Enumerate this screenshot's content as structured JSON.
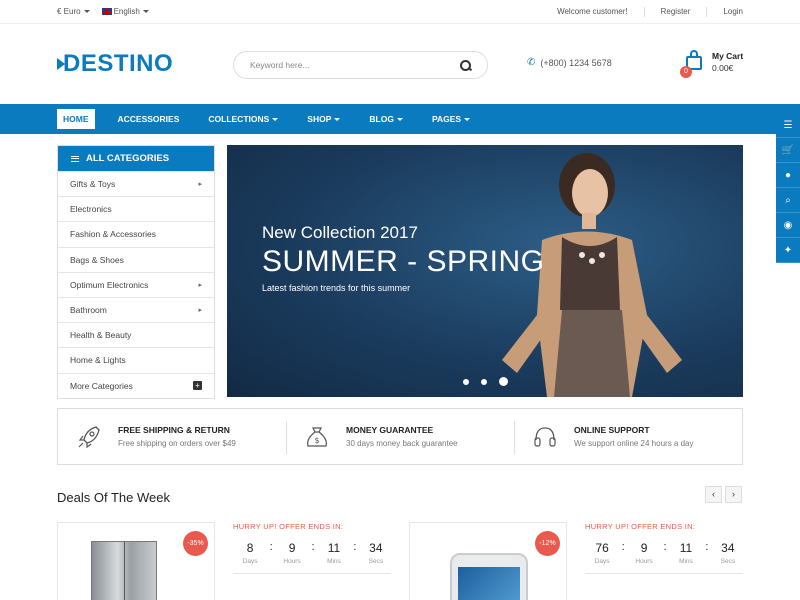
{
  "topbar": {
    "currency": "€ Euro",
    "language": "English",
    "welcome": "Welcome customer!",
    "register": "Register",
    "login": "Login"
  },
  "header": {
    "logo": "DESTINO",
    "search_placeholder": "Keyword here...",
    "phone": "(+800) 1234 5678",
    "cart_title": "My Cart",
    "cart_total": "0.00€",
    "cart_count": "0"
  },
  "nav": {
    "items": [
      "HOME",
      "ACCESSORIES",
      "COLLECTIONS",
      "SHOP",
      "BLOG",
      "PAGES"
    ]
  },
  "categories": {
    "title": "ALL CATEGORIES",
    "items": [
      "Gifts & Toys",
      "Electronics",
      "Fashion & Accessories",
      "Bags & Shoes",
      "Optimum Electronics",
      "Bathroom",
      "Health & Beauty",
      "Home & Lights",
      "More Categories"
    ]
  },
  "banner": {
    "subtitle": "New Collection 2017",
    "title": "SUMMER - SPRING",
    "text": "Latest fashion trends for this summer"
  },
  "features": [
    {
      "title": "FREE SHIPPING & RETURN",
      "desc": "Free shipping on orders over $49"
    },
    {
      "title": "MONEY GUARANTEE",
      "desc": "30 days money back guarantee"
    },
    {
      "title": "ONLINE SUPPORT",
      "desc": "We support online 24 hours a day"
    }
  ],
  "deals": {
    "title": "Deals Of The Week",
    "items": [
      {
        "badge": "-35%",
        "hurry": "HURRY UP! OFFER ENDS IN:",
        "days": "8",
        "hours": "9",
        "mins": "11",
        "secs": "34"
      },
      {
        "badge": "-12%",
        "hurry": "HURRY UP! OFFER ENDS IN:",
        "days": "76",
        "hours": "9",
        "mins": "11",
        "secs": "34"
      }
    ],
    "labels": {
      "days": "Days",
      "hours": "Hours",
      "mins": "Mins",
      "secs": "Secs"
    }
  },
  "colors": {
    "brand": "#0a7bbf",
    "accent": "#e9594d"
  },
  "icons": [
    "list-icon",
    "cart-icon",
    "user-icon",
    "search-icon",
    "eye-icon",
    "rocket-icon",
    "money-bag-icon",
    "headphones-icon"
  ]
}
